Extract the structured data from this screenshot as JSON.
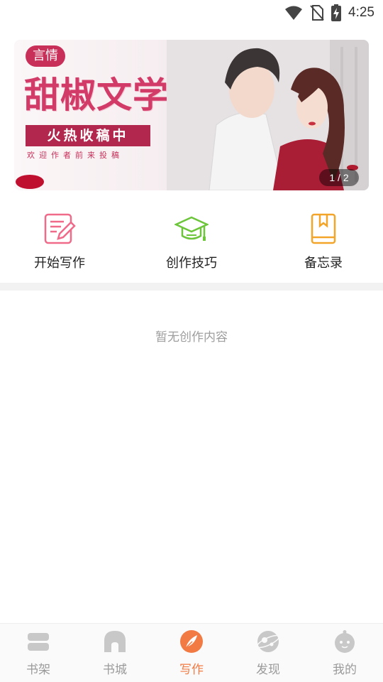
{
  "status_bar": {
    "time": "4:25",
    "icons": [
      "wifi-icon",
      "no-sim-icon",
      "battery-charging-icon"
    ]
  },
  "banner": {
    "badge": "言情",
    "title": "甜椒文学",
    "strip": "火热收稿中",
    "subtitle": "欢迎作者前来投稿",
    "page_indicator": "1 / 2"
  },
  "actions": [
    {
      "label": "开始写作",
      "icon": "edit-document-icon",
      "color": "#f06a8a"
    },
    {
      "label": "创作技巧",
      "icon": "graduation-cap-icon",
      "color": "#6cc53a"
    },
    {
      "label": "备忘录",
      "icon": "bookmark-book-icon",
      "color": "#f3a52a"
    }
  ],
  "empty_state": {
    "text": "暂无创作内容"
  },
  "tabbar": {
    "active_color": "#f27a43",
    "inactive_color": "#c8c8c8",
    "items": [
      {
        "label": "书架",
        "icon": "bookshelf-icon",
        "active": false
      },
      {
        "label": "书城",
        "icon": "bookstore-icon",
        "active": false
      },
      {
        "label": "写作",
        "icon": "quill-icon",
        "active": true
      },
      {
        "label": "发现",
        "icon": "planet-icon",
        "active": false
      },
      {
        "label": "我的",
        "icon": "profile-face-icon",
        "active": false
      }
    ]
  }
}
